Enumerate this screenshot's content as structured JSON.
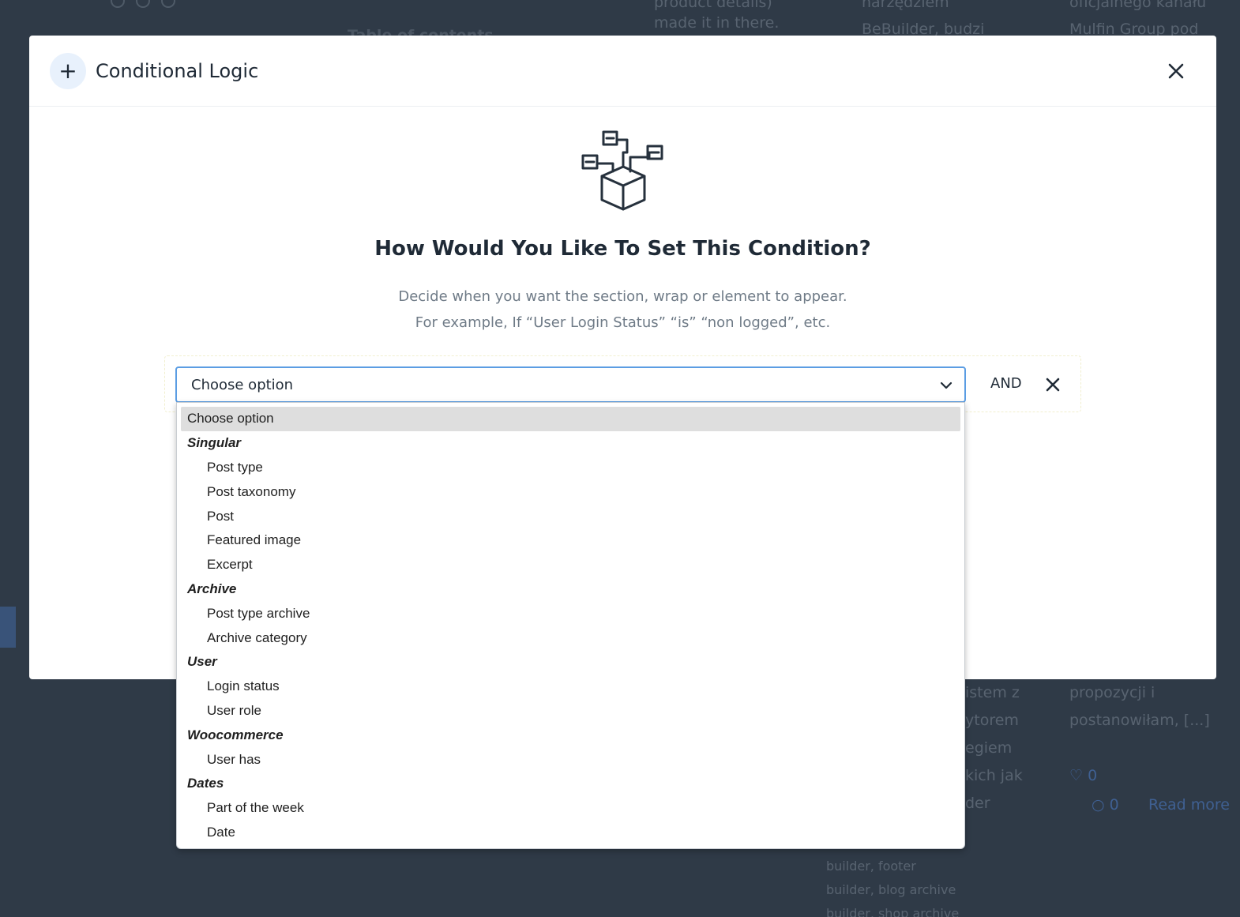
{
  "background": {
    "col1": [
      "product details)",
      "made it in there."
    ],
    "toc": "Table of contents",
    "col2_top": [
      "narzędziem",
      "BeBuilder, budzi"
    ],
    "col3_top": [
      "oficjalnego kanału",
      "Mulfin Group pod"
    ],
    "col2_bottom": [
      "istem z",
      "ytorem",
      "egiem",
      "kich jak",
      "der"
    ],
    "col3_bottom": [
      "propozycji i",
      "postanowiłam, [...]"
    ],
    "likes": "0",
    "comments": "0",
    "read_more": "Read more",
    "tags": [
      "builder, footer",
      "builder, blog archive",
      "builder, shop archive"
    ]
  },
  "modal": {
    "title": "Conditional Logic",
    "question": "How Would You Like To Set This Condition?",
    "desc_line1": "Decide when you want the section, wrap or element to appear.",
    "desc_line2": "For example, If “User Login Status” “is” “non logged”, etc.",
    "select_value": "Choose option",
    "and_label": "AND"
  },
  "dropdown": {
    "selected": "Choose option",
    "groups": [
      {
        "label": "Singular",
        "options": [
          "Post type",
          "Post taxonomy",
          "Post",
          "Featured image",
          "Excerpt"
        ]
      },
      {
        "label": "Archive",
        "options": [
          "Post type archive",
          "Archive category"
        ]
      },
      {
        "label": "User",
        "options": [
          "Login status",
          "User role"
        ]
      },
      {
        "label": "Woocommerce",
        "options": [
          "User has"
        ]
      },
      {
        "label": "Dates",
        "options": [
          "Part of the week",
          "Date"
        ]
      }
    ]
  },
  "icons": {
    "header": "plus-icon",
    "close": "close-icon",
    "illustration": "network-box-icon",
    "chevron": "chevron-down-icon",
    "remove": "close-icon"
  },
  "colors": {
    "overlay": "#2f3a47",
    "accent_border": "#5b9de3",
    "title_text": "#1f2a36",
    "muted_text": "#6f7b87",
    "selected_row": "#dedede"
  }
}
